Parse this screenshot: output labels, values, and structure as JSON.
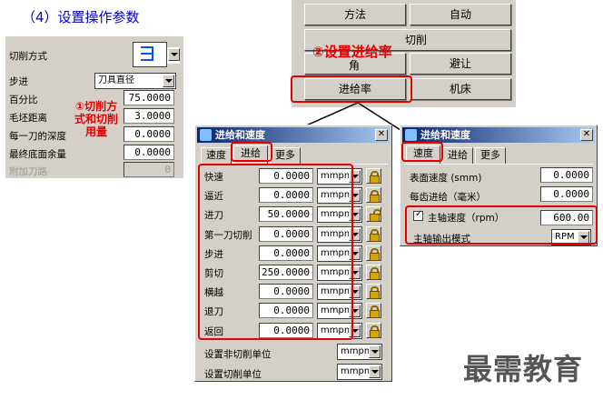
{
  "heading": "（4）设置操作参数",
  "watermark": "最需教育",
  "left_panel": {
    "rows": [
      {
        "label": "切削方式"
      },
      {
        "label": "步进",
        "combo": "刀具直径"
      },
      {
        "label": "百分比",
        "value": "75.0000"
      },
      {
        "label": "毛坯距离",
        "value": "3.0000"
      },
      {
        "label": "每一刀的深度",
        "value": "0.0000"
      },
      {
        "label": "最终底面余量",
        "value": "0.0000"
      },
      {
        "label": "附加刀路",
        "value": "0"
      }
    ],
    "annotation": "①切削方式和切削用量"
  },
  "top_buttons": {
    "method": "方法",
    "auto": "自动",
    "cut": "切削",
    "corner": "角",
    "avoid": "避让",
    "feedrate": "进给率",
    "machine": "机床",
    "annotation": "②设置进给率"
  },
  "dialog1": {
    "title": "进给和速度",
    "tabs": [
      "速度",
      "进给",
      "更多"
    ],
    "rows": [
      {
        "label": "快速",
        "value": "0.0000",
        "unit": "mmpm"
      },
      {
        "label": "逼近",
        "value": "0.0000",
        "unit": "mmpm"
      },
      {
        "label": "进刀",
        "value": "50.0000",
        "unit": "mmpm"
      },
      {
        "label": "第一刀切削",
        "value": "0.0000",
        "unit": "mmpm"
      },
      {
        "label": "步进",
        "value": "0.0000",
        "unit": "mmpm"
      },
      {
        "label": "剪切",
        "value": "250.0000",
        "unit": "mmpm"
      },
      {
        "label": "横越",
        "value": "0.0000",
        "unit": "mmpm"
      },
      {
        "label": "退刀",
        "value": "0.0000",
        "unit": "mmpm"
      },
      {
        "label": "返回",
        "value": "0.0000",
        "unit": "mmpm"
      }
    ],
    "noncut_unit_label": "设置非切削单位",
    "noncut_unit": "mmpm",
    "cut_unit_label": "设置切削单位",
    "cut_unit": "mmpm"
  },
  "dialog2": {
    "title": "进给和速度",
    "tabs": [
      "速度",
      "进给",
      "更多"
    ],
    "surface_speed_label": "表面速度 (smm)",
    "surface_speed": "0.0000",
    "feed_per_tooth_label": "每齿进给（毫米）",
    "feed_per_tooth": "0.0000",
    "spindle_label": "主轴速度（rpm）",
    "spindle_speed": "600.00",
    "spindle_mode_label": "主轴输出模式",
    "spindle_mode": "RPM"
  },
  "colors": {
    "annotation": "#e60000",
    "heading": "#0000c0",
    "panel": "#d4d0c8"
  }
}
